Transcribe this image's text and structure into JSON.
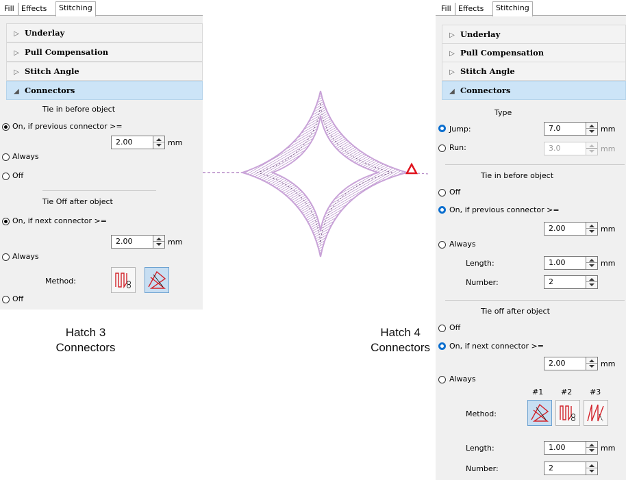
{
  "left_panel": {
    "tabs": [
      "Fill",
      "Effects",
      "Stitching"
    ],
    "sections": [
      "Underlay",
      "Pull Compensation",
      "Stitch Angle",
      "Connectors"
    ],
    "tie_in_heading": "Tie in before object",
    "tie_in_option_on": "On, if previous connector >=",
    "tie_in_value": "2.00",
    "unit_mm": "mm",
    "tie_in_always": "Always",
    "tie_in_off": "Off",
    "tie_off_heading": "Tie Off after object",
    "tie_off_option_on": "On, if next connector >=",
    "tie_off_value": "2.00",
    "tie_off_always": "Always",
    "method_label": "Method:",
    "tie_off_off": "Off"
  },
  "right_panel": {
    "tabs": [
      "Fill",
      "Effects",
      "Stitching"
    ],
    "sections": [
      "Underlay",
      "Pull Compensation",
      "Stitch Angle",
      "Connectors"
    ],
    "type_heading": "Type",
    "jump_label": "Jump:",
    "jump_value": "7.0",
    "run_label": "Run:",
    "run_value": "3.0",
    "unit_mm": "mm",
    "tie_in_heading": "Tie in before object",
    "tie_in_off": "Off",
    "tie_in_on": "On, if previous connector >=",
    "tie_in_value": "2.00",
    "tie_in_always": "Always",
    "length_label": "Length:",
    "tie_in_length": "1.00",
    "number_label": "Number:",
    "tie_in_number": "2",
    "tie_off_heading": "Tie off after object",
    "tie_off_off": "Off",
    "tie_off_on": "On, if next connector >=",
    "tie_off_value": "2.00",
    "tie_off_always": "Always",
    "method_cols": [
      "#1",
      "#2",
      "#3"
    ],
    "method_label": "Method:",
    "tie_off_length": "1.00",
    "tie_off_number": "2"
  },
  "captions": {
    "left_line1": "Hatch 3",
    "left_line2": "Connectors",
    "right_line1": "Hatch 4",
    "right_line2": "Connectors"
  },
  "colors": {
    "section_open": "#cce4f7",
    "radio_blue": "#0c6fcf",
    "stitch_purple": "#b58ac6",
    "marker_red": "#e0141e"
  }
}
